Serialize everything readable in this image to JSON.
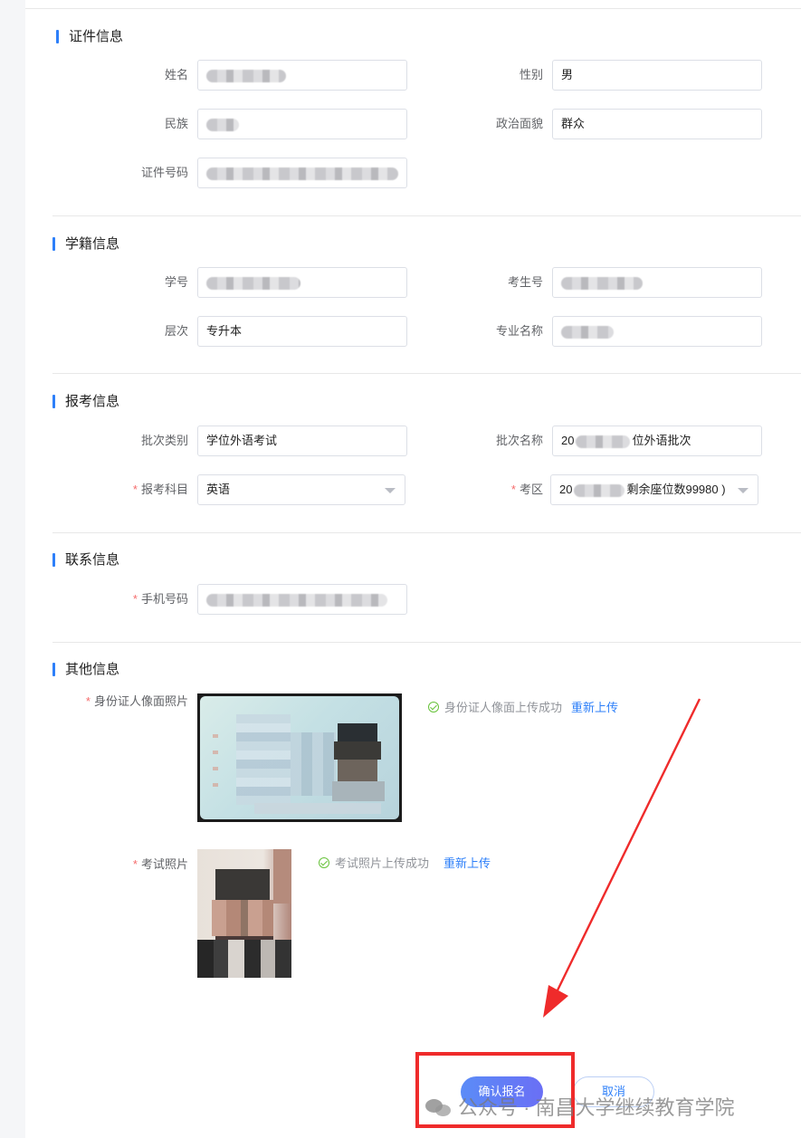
{
  "sections": {
    "id_info": {
      "title": "证件信息",
      "name_label": "姓名",
      "gender_label": "性别",
      "gender_value": "男",
      "ethnicity_label": "民族",
      "political_label": "政治面貌",
      "political_value": "群众",
      "id_number_label": "证件号码"
    },
    "enrollment": {
      "title": "学籍信息",
      "student_no_label": "学号",
      "exam_no_label": "考生号",
      "level_label": "层次",
      "level_value": "专升本",
      "major_label": "专业名称"
    },
    "registration": {
      "title": "报考信息",
      "batch_type_label": "批次类别",
      "batch_type_value": "学位外语考试",
      "batch_name_label": "批次名称",
      "batch_name_prefix": "20",
      "batch_name_suffix": "位外语批次",
      "subject_label": "报考科目",
      "subject_value": "英语",
      "area_label": "考区",
      "area_prefix": "20",
      "area_suffix": "剩余座位数99980 )"
    },
    "contact": {
      "title": "联系信息",
      "phone_label": "手机号码"
    },
    "other": {
      "title": "其他信息",
      "id_photo_label": "身份证人像面照片",
      "id_photo_status": "身份证人像面上传成功",
      "exam_photo_label": "考试照片",
      "exam_photo_status": "考试照片上传成功",
      "reupload_label": "重新上传"
    }
  },
  "actions": {
    "confirm_label": "确认报名",
    "cancel_label": "取消"
  },
  "watermark": {
    "text": "公众号 · 南昌大学继续教育学院"
  },
  "colors": {
    "accent": "#2d7ff9",
    "required": "#f56c6c",
    "annotation": "#ef2b2b",
    "success": "#67c23a"
  }
}
